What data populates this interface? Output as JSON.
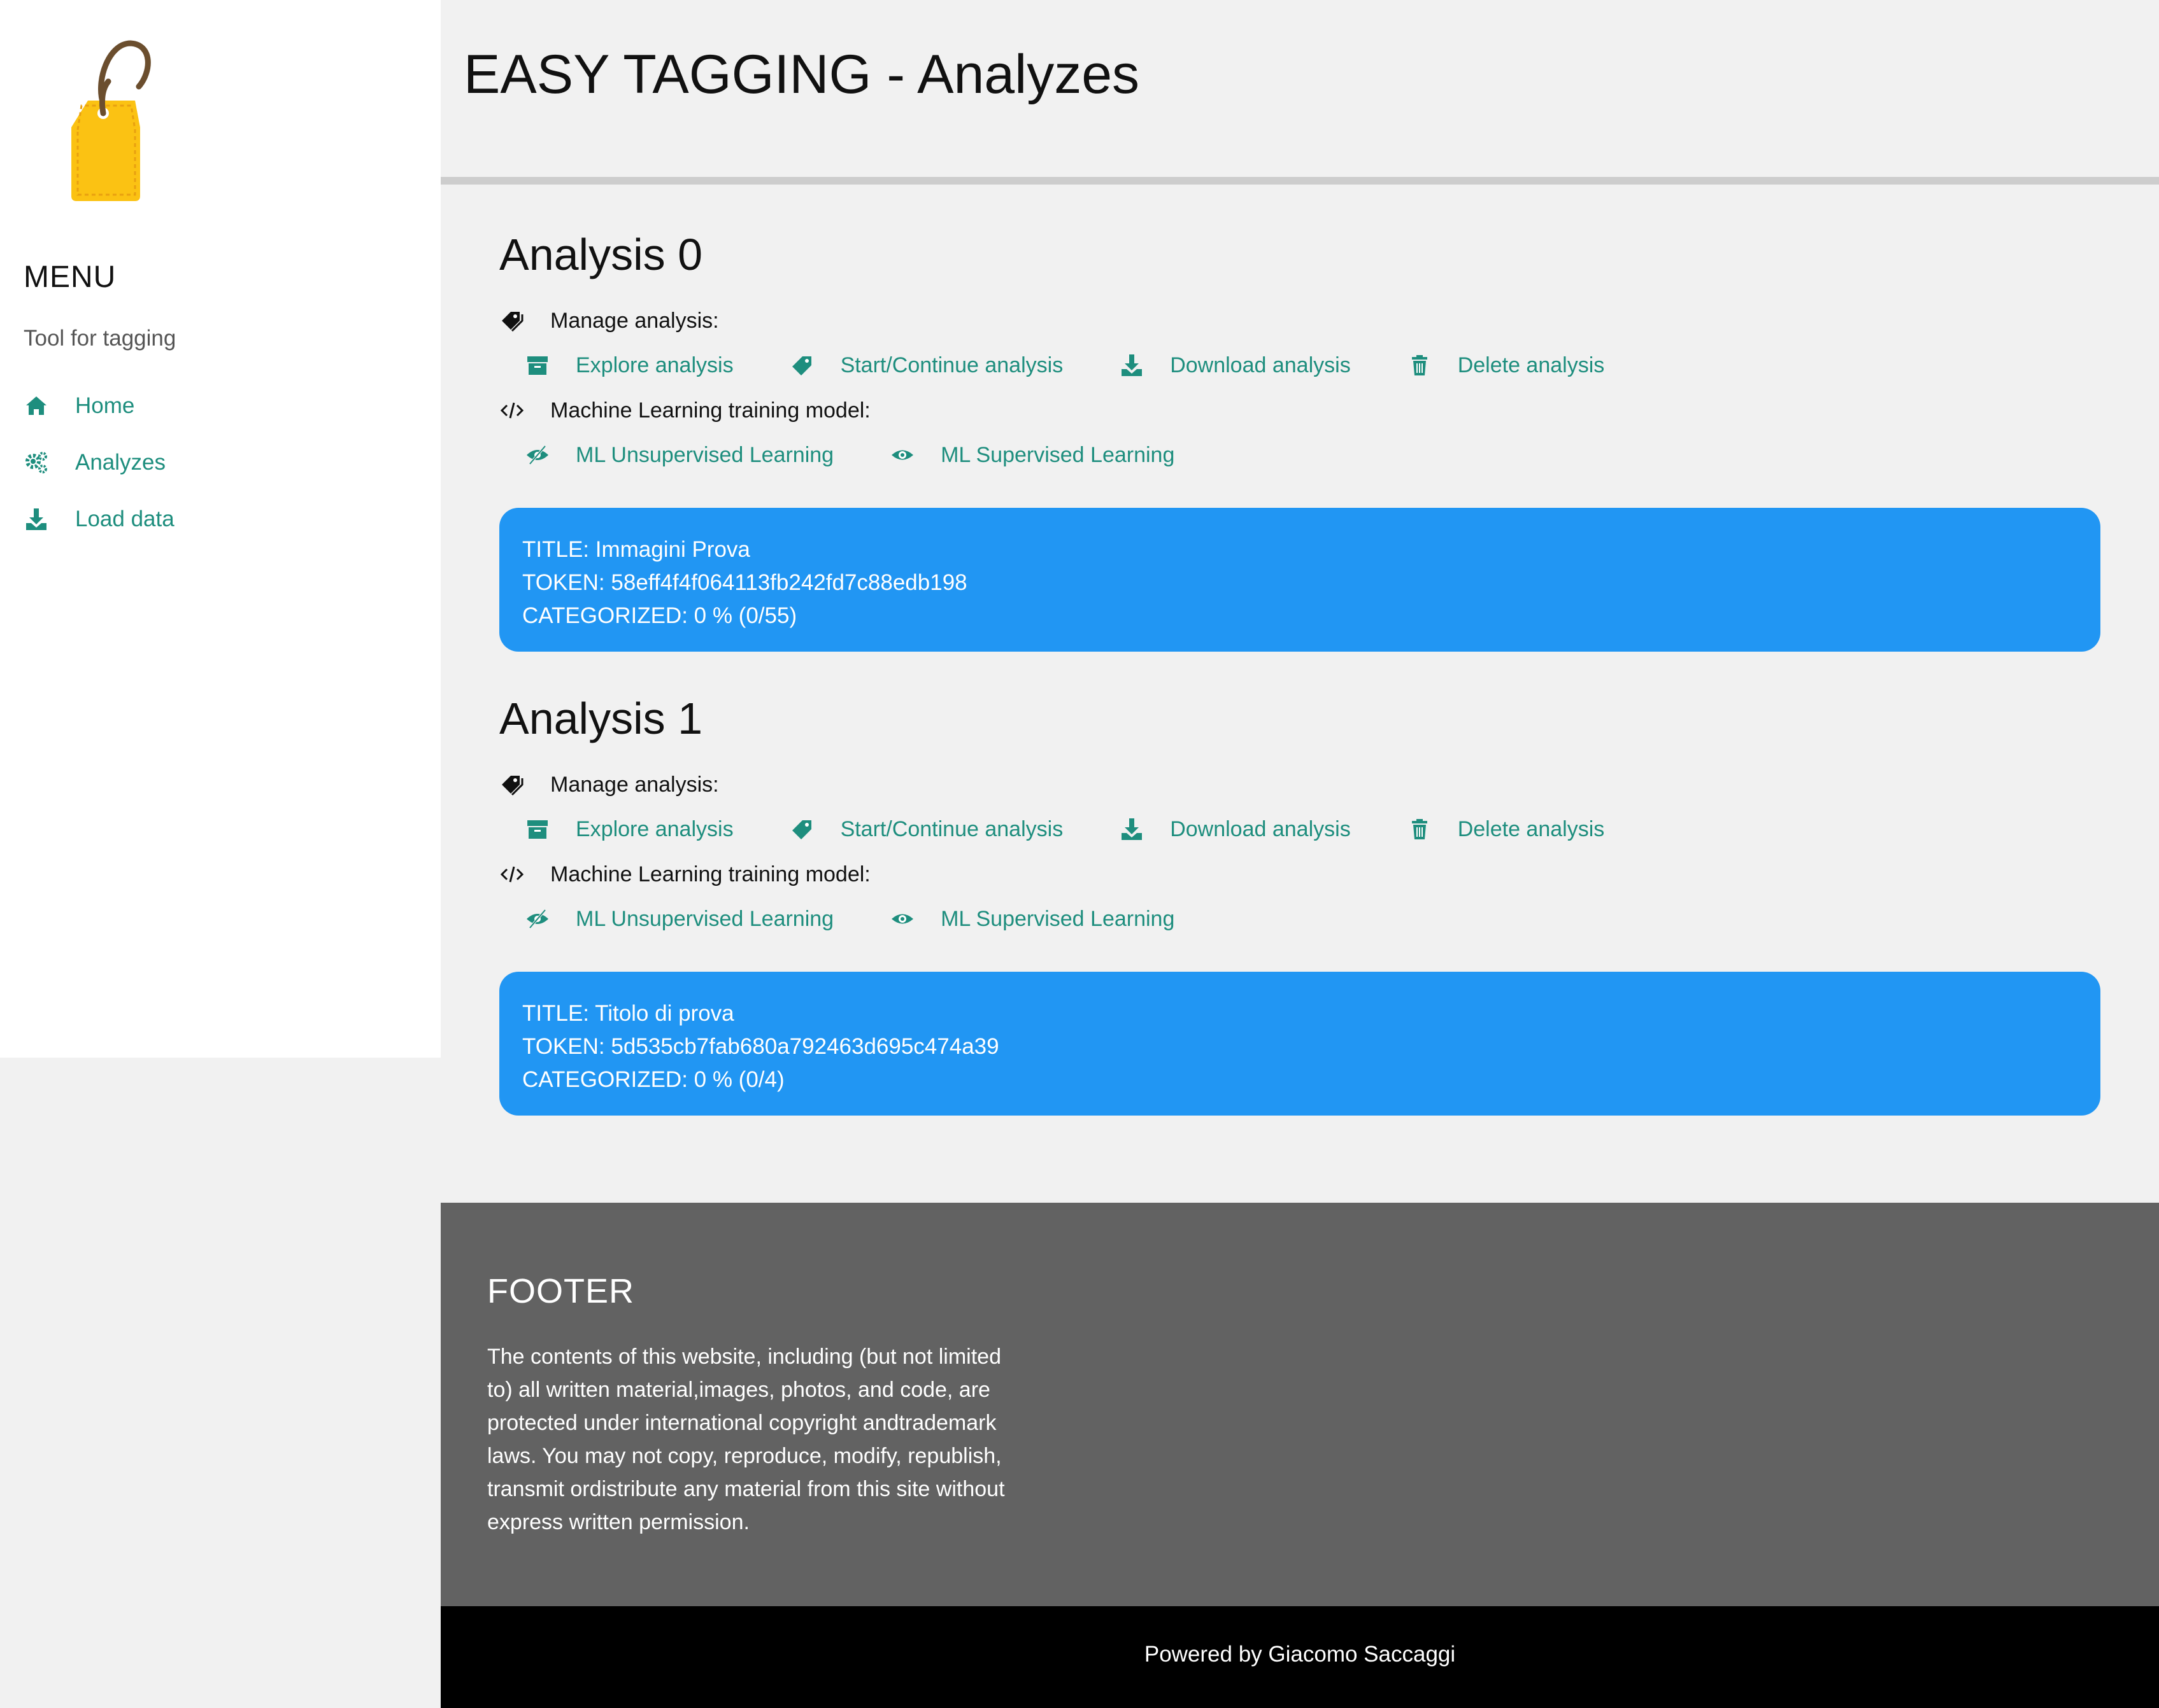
{
  "sidebar": {
    "menu_title": "MENU",
    "subtitle": "Tool for tagging",
    "items": [
      {
        "label": "Home",
        "icon": "home-icon"
      },
      {
        "label": "Analyzes",
        "icon": "gears-icon"
      },
      {
        "label": "Load data",
        "icon": "download-icon"
      }
    ]
  },
  "header": {
    "title": "EASY TAGGING - Analyzes"
  },
  "colors": {
    "accent_link": "#1e8e7e",
    "card_blue": "#2196f3",
    "footer_gray": "#626262",
    "logo_tag": "#fbc213",
    "logo_string": "#6b4e2e"
  },
  "analyses": [
    {
      "title": "Analysis 0",
      "manage_label": "Manage analysis:",
      "actions": [
        {
          "label": "Explore analysis",
          "icon": "archive-icon"
        },
        {
          "label": "Start/Continue analysis",
          "icon": "tag-icon"
        },
        {
          "label": "Download analysis",
          "icon": "download-icon"
        },
        {
          "label": "Delete analysis",
          "icon": "trash-icon"
        }
      ],
      "ml_label": "Machine Learning training model:",
      "ml_actions": [
        {
          "label": "ML Unsupervised Learning",
          "icon": "eye-slash-icon"
        },
        {
          "label": "ML Supervised Learning",
          "icon": "eye-icon"
        }
      ],
      "card": {
        "title_line": "TITLE: Immagini Prova",
        "token_line": "TOKEN: 58eff4f4f064113fb242fd7c88edb198",
        "categorized_line": "CATEGORIZED: 0 % (0/55)"
      }
    },
    {
      "title": "Analysis 1",
      "manage_label": "Manage analysis:",
      "actions": [
        {
          "label": "Explore analysis",
          "icon": "archive-icon"
        },
        {
          "label": "Start/Continue analysis",
          "icon": "tag-icon"
        },
        {
          "label": "Download analysis",
          "icon": "download-icon"
        },
        {
          "label": "Delete analysis",
          "icon": "trash-icon"
        }
      ],
      "ml_label": "Machine Learning training model:",
      "ml_actions": [
        {
          "label": "ML Unsupervised Learning",
          "icon": "eye-slash-icon"
        },
        {
          "label": "ML Supervised Learning",
          "icon": "eye-icon"
        }
      ],
      "card": {
        "title_line": "TITLE: Titolo di prova",
        "token_line": "TOKEN: 5d535cb7fab680a792463d695c474a39",
        "categorized_line": "CATEGORIZED: 0 % (0/4)"
      }
    }
  ],
  "footer": {
    "title": "FOOTER",
    "text": "The contents of this website, including (but not limited to) all written material,images, photos, and code, are protected under international copyright andtrademark laws. You may not copy, reproduce, modify, republish, transmit ordistribute any material from this site without express written permission.",
    "powered_by": "Powered by Giacomo Saccaggi"
  }
}
